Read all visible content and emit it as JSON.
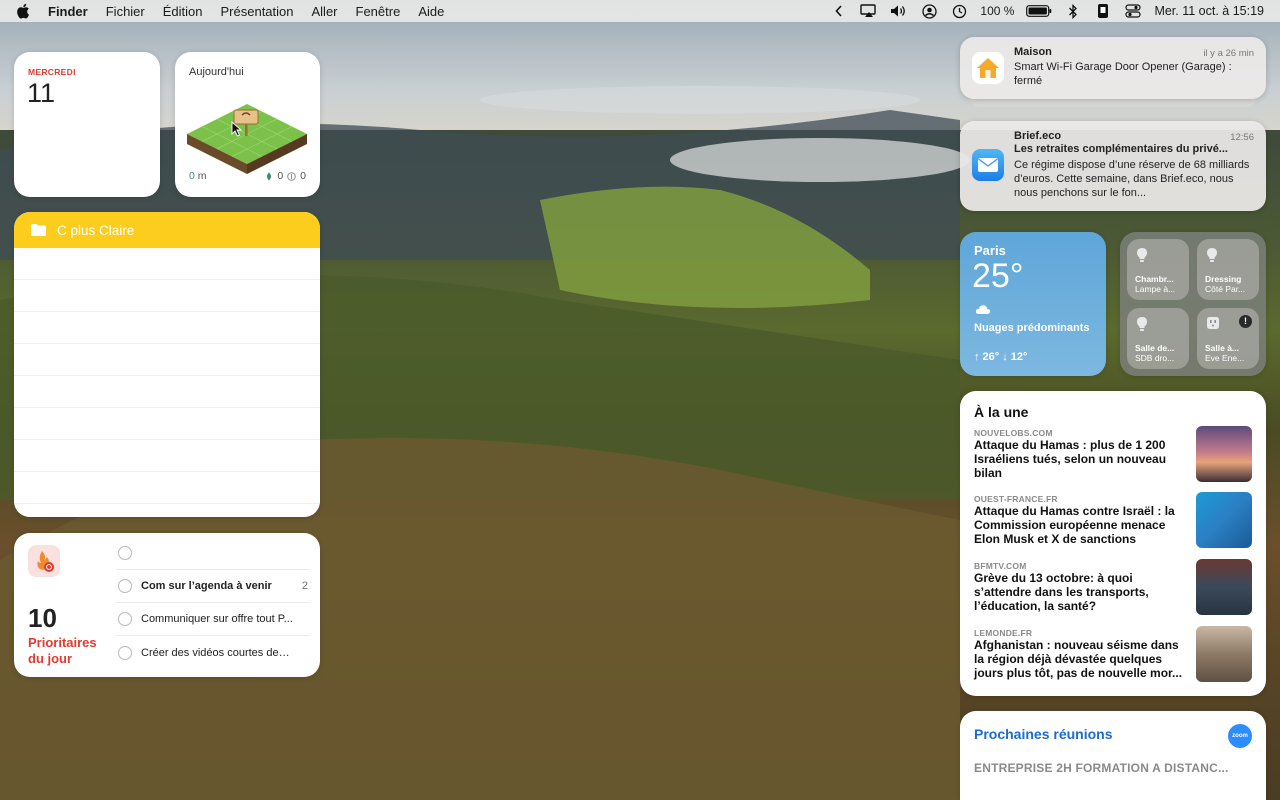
{
  "menubar": {
    "items": [
      "Finder",
      "Fichier",
      "Édition",
      "Présentation",
      "Aller",
      "Fenêtre",
      "Aide"
    ],
    "battery": "100 %",
    "clock": "Mer. 11 oct. à 15:19",
    "icons": [
      "apple-icon",
      "chevron-left-icon",
      "screen-mirror-icon",
      "volume-icon",
      "user-icon",
      "time-machine-icon",
      "battery-icon",
      "bluetooth-icon",
      "phone-icon",
      "control-center-icon"
    ]
  },
  "calendar": {
    "day": "MERCREDI",
    "date": "11"
  },
  "today": {
    "title": "Aujourd'hui",
    "distance_value": "0",
    "distance_unit": "m",
    "stat1": "0",
    "stat2": "0"
  },
  "notes": {
    "folder": "C plus Claire"
  },
  "reminders": {
    "count": "10",
    "label": "Prioritaires du jour",
    "items": [
      {
        "text": "",
        "count": ""
      },
      {
        "text": "Com sur l’agenda à venir",
        "count": "2"
      },
      {
        "text": "Communiquer sur offre tout P...",
        "count": ""
      },
      {
        "text": "Créer des vidéos courtes des...",
        "count": ""
      }
    ]
  },
  "notifications": [
    {
      "app": "Maison",
      "time": "il y a 26 min",
      "message": "Smart Wi-Fi Garage Door Opener (Garage) : fermé"
    },
    {
      "app": "Brief.eco",
      "time": "12:56",
      "title": "Les retraites complémentaires du privé...",
      "message": "Ce régime dispose d’une réserve de 68 milliards d’euros. Cette semaine, dans Brief.eco, nous nous penchons sur le fon..."
    }
  ],
  "weather": {
    "city": "Paris",
    "temp": "25°",
    "condition": "Nuages prédominants",
    "highlow": "↑ 26° ↓ 12°"
  },
  "home": {
    "tiles": [
      {
        "name": "Chambr...",
        "detail": "Lampe à..."
      },
      {
        "name": "Dressing",
        "detail": "Côté Par..."
      },
      {
        "name": "Salle de...",
        "detail": "SDB dro..."
      },
      {
        "name": "Salle à...",
        "detail": "Eve Ene..."
      }
    ]
  },
  "news": {
    "title": "À la une",
    "items": [
      {
        "source": "NOUVELOBS.COM",
        "headline": "Attaque du Hamas : plus de 1 200 Israéliens tués, selon un nouveau bilan"
      },
      {
        "source": "OUEST-FRANCE.FR",
        "headline": "Attaque du Hamas contre Israël : la Commission européenne menace Elon Musk et X de sanctions"
      },
      {
        "source": "BFMTV.COM",
        "headline": "Grève du 13 octobre: à quoi s’attendre dans les transports, l’éducation, la santé?"
      },
      {
        "source": "LEMONDE.FR",
        "headline": "Afghanistan : nouveau séisme dans la région déjà dévastée quelques jours plus tôt, pas de nouvelle mor..."
      }
    ]
  },
  "meetings": {
    "title": "Prochaines réunions",
    "subtitle": "ENTREPRISE 2H FORMATION A DISTANC...",
    "zoom_label": "zoom"
  }
}
